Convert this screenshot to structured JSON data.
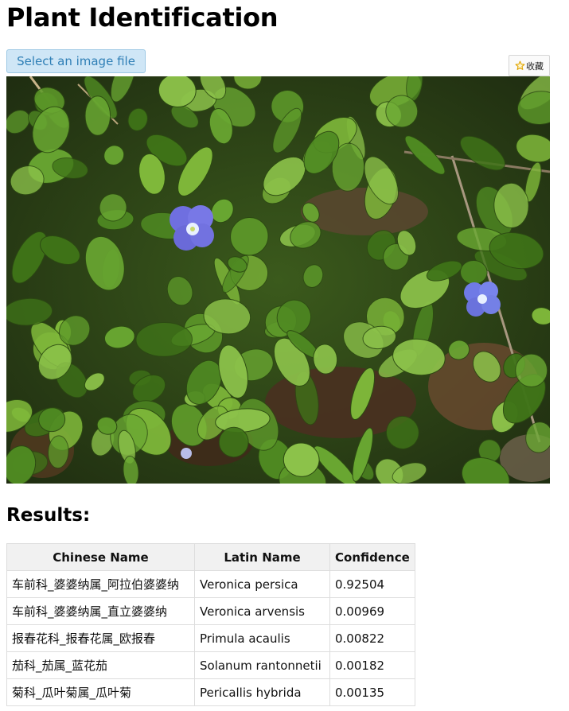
{
  "page": {
    "title": "Plant Identification",
    "select_button_label": "Select an image file",
    "favorite_button_label": "收藏",
    "favorite_icon": "star-icon"
  },
  "photo": {
    "subject": "photo-of-small-blue-flowers-among-green-leaves",
    "colors": {
      "leaf": "#4f8a22",
      "leaf_light": "#7fb83a",
      "soil": "#3d2a1a",
      "flower": "#6f6fe0",
      "flower_center": "#e8f0ff"
    }
  },
  "results": {
    "heading": "Results:",
    "columns": [
      "Chinese Name",
      "Latin Name",
      "Confidence"
    ],
    "rows": [
      {
        "chinese": "车前科_婆婆纳属_阿拉伯婆婆纳",
        "latin": "Veronica persica",
        "confidence": "0.92504"
      },
      {
        "chinese": "车前科_婆婆纳属_直立婆婆纳",
        "latin": "Veronica arvensis",
        "confidence": "0.00969"
      },
      {
        "chinese": "报春花科_报春花属_欧报春",
        "latin": "Primula acaulis",
        "confidence": "0.00822"
      },
      {
        "chinese": "茄科_茄属_蓝花茄",
        "latin": "Solanum rantonnetii",
        "confidence": "0.00182"
      },
      {
        "chinese": "菊科_瓜叶菊属_瓜叶菊",
        "latin": "Pericallis hybrida",
        "confidence": "0.00135"
      }
    ]
  }
}
